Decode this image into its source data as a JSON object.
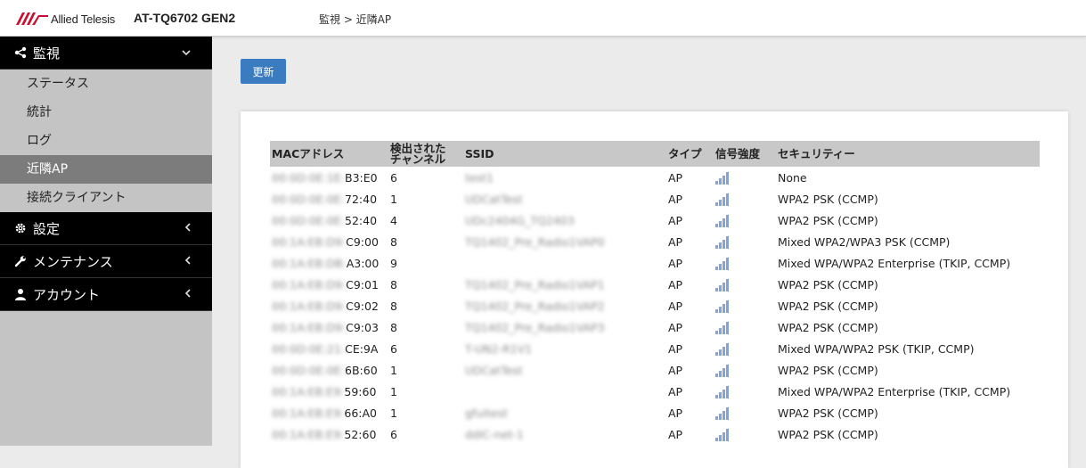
{
  "header": {
    "brand": "Allied Telesis",
    "model": "AT-TQ6702 GEN2",
    "breadcrumb": "監視 > 近隣AP",
    "colors": {
      "logo": "#c8102e",
      "accent": "#3b7bbf"
    }
  },
  "sidebar": {
    "groups": [
      {
        "label": "監視",
        "icon": "share-icon",
        "expanded": true,
        "items": [
          {
            "label": "ステータス"
          },
          {
            "label": "統計"
          },
          {
            "label": "ログ"
          },
          {
            "label": "近隣AP",
            "active": true
          },
          {
            "label": "接続クライアント"
          }
        ]
      },
      {
        "label": "設定",
        "icon": "gear-icon",
        "expanded": false
      },
      {
        "label": "メンテナンス",
        "icon": "wrench-icon",
        "expanded": false
      },
      {
        "label": "アカウント",
        "icon": "user-icon",
        "expanded": false
      }
    ]
  },
  "main": {
    "refresh_label": "更新",
    "table": {
      "headers": {
        "mac": "MACアドレス",
        "channel_line1": "検出された",
        "channel_line2": "チャンネル",
        "ssid": "SSID",
        "type": "タイプ",
        "signal": "信号強度",
        "security": "セキュリティー"
      },
      "rows": [
        {
          "mac_masked": "00:0D:0E:1E:",
          "mac_tail": "B3:E0",
          "channel": "6",
          "ssid_masked": "test1",
          "type": "AP",
          "signal": "signal-bars-icon",
          "security": "None"
        },
        {
          "mac_masked": "00:0D:0E:0E:",
          "mac_tail": "72:40",
          "channel": "1",
          "ssid_masked": "UDCatTest",
          "type": "AP",
          "signal": "signal-bars-icon",
          "security": "WPA2 PSK (CCMP)"
        },
        {
          "mac_masked": "00:0D:0E:0E:",
          "mac_tail": "52:40",
          "channel": "4",
          "ssid_masked": "UDc2404G_TQ2403",
          "type": "AP",
          "signal": "signal-bars-icon",
          "security": "WPA2 PSK (CCMP)"
        },
        {
          "mac_masked": "00:1A:EB:D9:",
          "mac_tail": "C9:00",
          "channel": "8",
          "ssid_masked": "TQ1402_Pre_Radio1VAP0",
          "type": "AP",
          "signal": "signal-bars-icon",
          "security": "Mixed WPA2/WPA3 PSK (CCMP)"
        },
        {
          "mac_masked": "00:1A:EB:DB:",
          "mac_tail": "A3:00",
          "channel": "9",
          "ssid_masked": "",
          "type": "AP",
          "signal": "signal-bars-icon",
          "security": "Mixed WPA/WPA2 Enterprise (TKIP, CCMP)"
        },
        {
          "mac_masked": "00:1A:EB:D9:",
          "mac_tail": "C9:01",
          "channel": "8",
          "ssid_masked": "TQ1402_Pre_Radio1VAP1",
          "type": "AP",
          "signal": "signal-bars-icon",
          "security": "WPA2 PSK (CCMP)"
        },
        {
          "mac_masked": "00:1A:EB:D9:",
          "mac_tail": "C9:02",
          "channel": "8",
          "ssid_masked": "TQ1402_Pre_Radio1VAP2",
          "type": "AP",
          "signal": "signal-bars-icon",
          "security": "WPA2 PSK (CCMP)"
        },
        {
          "mac_masked": "00:1A:EB:D9:",
          "mac_tail": "C9:03",
          "channel": "8",
          "ssid_masked": "TQ1402_Pre_Radio1VAP3",
          "type": "AP",
          "signal": "signal-bars-icon",
          "security": "WPA2 PSK (CCMP)"
        },
        {
          "mac_masked": "00:0D:0E:21:",
          "mac_tail": "CE:9A",
          "channel": "6",
          "ssid_masked": "T-UN2-R1V1",
          "type": "AP",
          "signal": "signal-bars-icon",
          "security": "Mixed WPA/WPA2 PSK (TKIP, CCMP)"
        },
        {
          "mac_masked": "00:0D:0E:0E:",
          "mac_tail": "6B:60",
          "channel": "1",
          "ssid_masked": "UDCatTest",
          "type": "AP",
          "signal": "signal-bars-icon",
          "security": "WPA2 PSK (CCMP)"
        },
        {
          "mac_masked": "00:1A:EB:E9:",
          "mac_tail": "59:60",
          "channel": "1",
          "ssid_masked": "",
          "type": "AP",
          "signal": "signal-bars-icon",
          "security": "Mixed WPA/WPA2 Enterprise (TKIP, CCMP)"
        },
        {
          "mac_masked": "00:1A:EB:E9:",
          "mac_tail": "66:A0",
          "channel": "1",
          "ssid_masked": "gfuitest",
          "type": "AP",
          "signal": "signal-bars-icon",
          "security": "WPA2 PSK (CCMP)"
        },
        {
          "mac_masked": "00:1A:EB:E9:",
          "mac_tail": "52:60",
          "channel": "6",
          "ssid_masked": "ddIC-net-1",
          "type": "AP",
          "signal": "signal-bars-icon",
          "security": "WPA2 PSK (CCMP)"
        }
      ]
    }
  }
}
